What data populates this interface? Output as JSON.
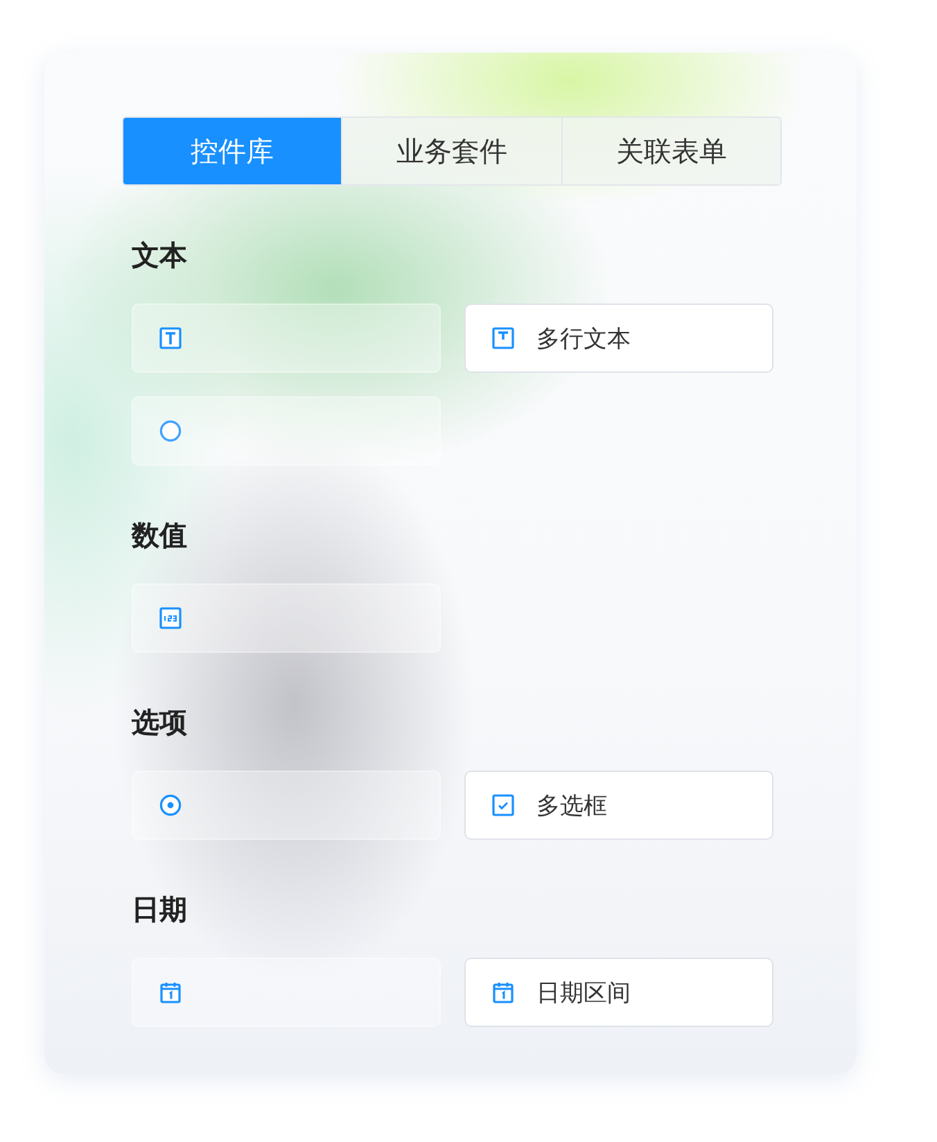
{
  "tabs": [
    {
      "label": "控件库",
      "selected": true
    },
    {
      "label": "业务套件",
      "selected": false
    },
    {
      "label": "关联表单",
      "selected": false
    }
  ],
  "sections": [
    {
      "title": "文本",
      "items": [
        {
          "kind": "text",
          "faded": true
        },
        {
          "kind": "textarea",
          "label": "多行文本",
          "faded": false
        },
        {
          "kind": "circle",
          "faded": true
        }
      ]
    },
    {
      "title": "数值",
      "items": [
        {
          "kind": "number",
          "faded": true
        }
      ]
    },
    {
      "title": "选项",
      "items": [
        {
          "kind": "radio",
          "faded": true
        },
        {
          "kind": "checkbox",
          "label": "多选框",
          "faded": false
        }
      ]
    },
    {
      "title": "日期",
      "items": [
        {
          "kind": "calendar",
          "faded": true
        },
        {
          "kind": "calendar",
          "label": "日期区间",
          "faded": false
        }
      ]
    }
  ]
}
